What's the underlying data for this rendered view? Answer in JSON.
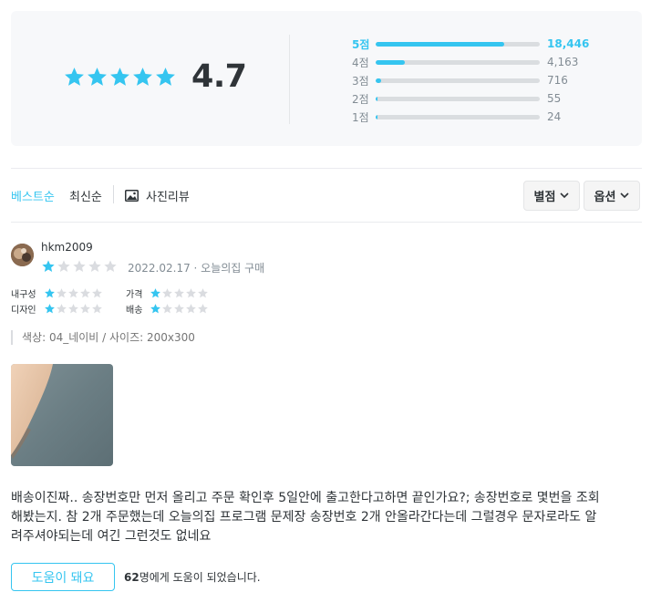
{
  "summary": {
    "average": "4.7",
    "average_stars": 5,
    "distribution": [
      {
        "label": "5점",
        "count": "18,446",
        "fraction": 0.785,
        "active": true
      },
      {
        "label": "4점",
        "count": "4,163",
        "fraction": 0.177,
        "active": false
      },
      {
        "label": "3점",
        "count": "716",
        "fraction": 0.031,
        "active": false
      },
      {
        "label": "2점",
        "count": "55",
        "fraction": 0.003,
        "active": false
      },
      {
        "label": "1점",
        "count": "24",
        "fraction": 0.002,
        "active": false
      }
    ]
  },
  "filters": {
    "sort_best": "베스트순",
    "sort_latest": "최신순",
    "photo_review": "사진리뷰",
    "rating_dropdown": "별점",
    "option_dropdown": "옵션"
  },
  "review": {
    "username": "hkm2009",
    "rating": 1,
    "date_source": "2022.02.17 · 오늘의집 구매",
    "sub_ratings": [
      {
        "label": "내구성",
        "rating": 1
      },
      {
        "label": "가격",
        "rating": 1
      },
      {
        "label": "디자인",
        "rating": 1
      },
      {
        "label": "배송",
        "rating": 1
      }
    ],
    "options": "색상: 04_네이비 / 사이즈: 200x300",
    "content_line1": "배송이진짜.. 송장번호만 먼저 올리고 주문 확인후 5일안에 출고한다고하면 끝인가요?; 송장번호로 몇번을 조회",
    "content_line2": "해봤는지. 참 2개 주문했는데 오늘의집 프로그램 문제장 송장번호 2개 안올라간다는데 그럴경우 문자로라도 알",
    "content_line3": "려주셔야되는데 여긴 그런것도 없네요",
    "helpful_button": "도움이 돼요",
    "helpful_count": "62",
    "helpful_suffix": "명에게 도움이 되었습니다."
  },
  "colors": {
    "accent": "#35c5f0",
    "star_empty": "#dadce0"
  }
}
